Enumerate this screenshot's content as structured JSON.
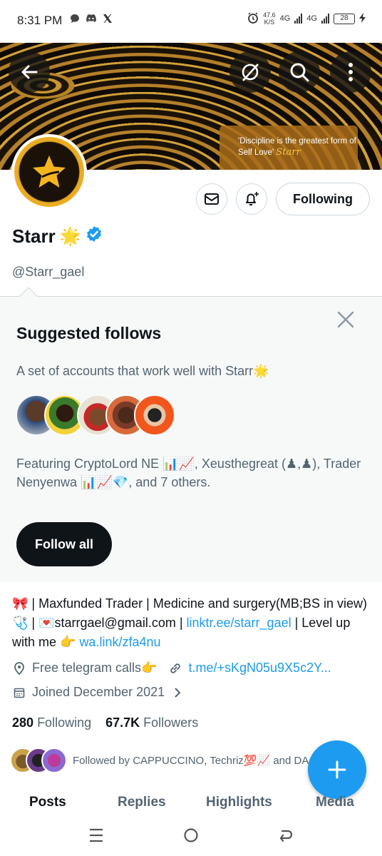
{
  "status_bar": {
    "time": "8:31 PM",
    "notification_icons": [
      "chat-bubble-icon",
      "discord-icon",
      "x-logo-icon"
    ],
    "net_speed_top": "47.6",
    "net_speed_bottom": "K/S",
    "network_1": "4G",
    "network_2": "4G",
    "battery": "28"
  },
  "banner": {
    "quote": "'Discipline is the greatest form of Self Love'",
    "signature": "Starr"
  },
  "profile": {
    "name": "Starr",
    "name_emoji": "🌟",
    "handle": "@Starr_gael",
    "following_button": "Following"
  },
  "suggested": {
    "title": "Suggested follows",
    "description": "A set of accounts that work well with Starr🌟",
    "featuring": "Featuring CryptoLord NE 📊📈, Xeusthegreat (♟,♟), Trader Nenyenwa 📊📈💎, and 7 others.",
    "follow_all": "Follow all"
  },
  "bio": {
    "part1": "🎀 | Maxfunded Trader | Medicine and surgery(MB;BS in view)🩺 | 💌starrgael@gmail.com | ",
    "link1": "linktr.ee/starr_gael",
    "part2": " | Level up with me 👉 ",
    "link2": "wa.link/zfa4nu"
  },
  "meta": {
    "location": "Free telegram calls👉",
    "website": "t.me/+sKgN05u9X5c2Y...",
    "joined": "Joined December 2021"
  },
  "stats": {
    "following_count": "280",
    "following_label": "Following",
    "followers_count": "67.7K",
    "followers_label": "Followers"
  },
  "followed_by": "Followed by CAPPUCCINO, Techriz💯📈 and DA",
  "tabs": [
    "Posts",
    "Replies",
    "Highlights",
    "Media"
  ],
  "colors": {
    "accent": "#1d9bf0",
    "verified": "#1d9bf0",
    "text_primary": "#0f1419",
    "text_secondary": "#536471"
  }
}
